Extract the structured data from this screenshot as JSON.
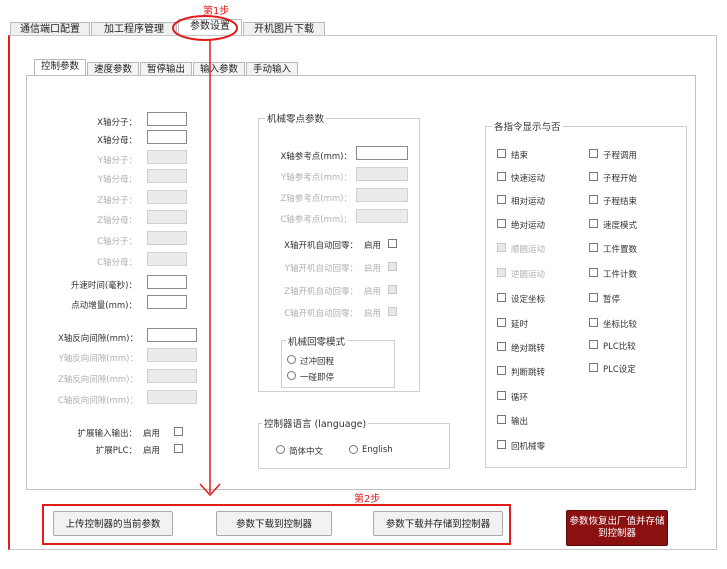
{
  "tabs": [
    "通信端口配置",
    "加工程序管理",
    "参数设置",
    "开机图片下载"
  ],
  "annotations": {
    "step1": "第1步",
    "step2": "第2步"
  },
  "subtabs": [
    "控制参数",
    "速度参数",
    "暂停输出",
    "输入参数",
    "手动输入"
  ],
  "left": {
    "axis_fields": [
      {
        "label": "X轴分子：",
        "enabled": true
      },
      {
        "label": "X轴分母：",
        "enabled": true
      },
      {
        "label": "Y轴分子：",
        "enabled": false
      },
      {
        "label": "Y轴分母：",
        "enabled": false
      },
      {
        "label": "Z轴分子：",
        "enabled": false
      },
      {
        "label": "Z轴分母：",
        "enabled": false
      },
      {
        "label": "C轴分子：",
        "enabled": false
      },
      {
        "label": "C轴分母：",
        "enabled": false
      }
    ],
    "accel_label": "升速时间(毫秒)：",
    "jog_label": "点动增量(mm)：",
    "backlash_fields": [
      {
        "label": "X轴反向间隙(mm)：",
        "enabled": true
      },
      {
        "label": "Y轴反向间隙(mm)：",
        "enabled": false
      },
      {
        "label": "Z轴反向间隙(mm)：",
        "enabled": false
      },
      {
        "label": "C轴反向间隙(mm)：",
        "enabled": false
      }
    ],
    "ext_input_label": "扩展输入输出：",
    "ext_plc_label": "扩展PLC：",
    "enable_text": "启用"
  },
  "zero": {
    "title": "机械零点参数",
    "ref_fields": [
      {
        "label": "X轴参考点(mm)：",
        "enabled": true
      },
      {
        "label": "Y轴参考点(mm)：",
        "enabled": false
      },
      {
        "label": "Z轴参考点(mm)：",
        "enabled": false
      },
      {
        "label": "C轴参考点(mm)：",
        "enabled": false
      }
    ],
    "auto_home": [
      {
        "label": "X轴开机自动回零：",
        "enabled": true
      },
      {
        "label": "Y轴开机自动回零：",
        "enabled": false
      },
      {
        "label": "Z轴开机自动回零：",
        "enabled": false
      },
      {
        "label": "C轴开机自动回零：",
        "enabled": false
      }
    ],
    "enable_text": "启用",
    "mode_title": "机械回零模式",
    "mode_options": [
      "过冲回程",
      "一碰即停"
    ]
  },
  "language": {
    "title": "控制器语言 (language)",
    "options": [
      "简体中文",
      "English"
    ]
  },
  "display": {
    "title": "各指令显示与否",
    "col1": [
      {
        "label": "结束",
        "enabled": true
      },
      {
        "label": "快速运动",
        "enabled": true
      },
      {
        "label": "相对运动",
        "enabled": true
      },
      {
        "label": "绝对运动",
        "enabled": true
      },
      {
        "label": "顺圆运动",
        "enabled": false
      },
      {
        "label": "逆圆运动",
        "enabled": false
      },
      {
        "label": "设定坐标",
        "enabled": true
      },
      {
        "label": "延时",
        "enabled": true
      },
      {
        "label": "绝对跳转",
        "enabled": true
      },
      {
        "label": "判断跳转",
        "enabled": true
      },
      {
        "label": "循环",
        "enabled": true
      },
      {
        "label": "输出",
        "enabled": true
      },
      {
        "label": "回机械零",
        "enabled": true
      }
    ],
    "col2": [
      {
        "label": "子程调用",
        "enabled": true
      },
      {
        "label": "子程开始",
        "enabled": true
      },
      {
        "label": "子程结束",
        "enabled": true
      },
      {
        "label": "速度模式",
        "enabled": true
      },
      {
        "label": "工件置数",
        "enabled": true
      },
      {
        "label": "工件计数",
        "enabled": true
      },
      {
        "label": "暂停",
        "enabled": true
      },
      {
        "label": "坐标比较",
        "enabled": true
      },
      {
        "label": "PLC比较",
        "enabled": true
      },
      {
        "label": "PLC设定",
        "enabled": true
      }
    ]
  },
  "buttons": {
    "upload": "上传控制器的当前参数",
    "download": "参数下载到控制器",
    "download_save": "参数下载并存储到控制器",
    "factory": "参数恢复出厂值并存储到控制器"
  },
  "colors": {
    "accent": "#e21b1b",
    "factory_btn": "#8b1010"
  }
}
